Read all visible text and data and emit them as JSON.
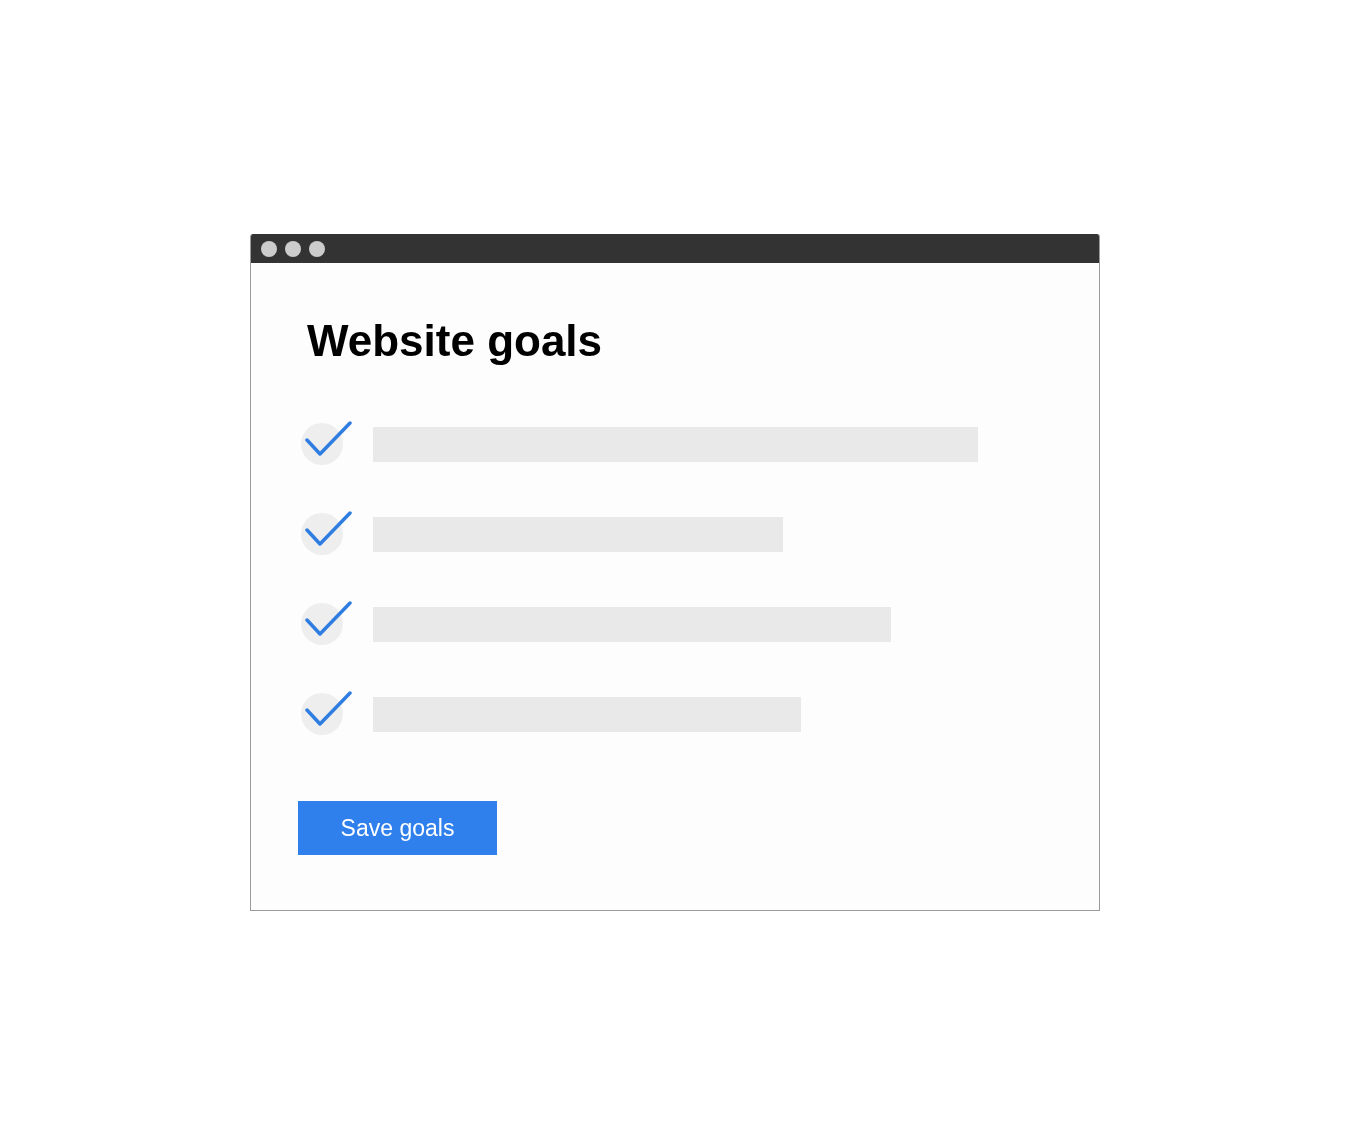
{
  "title": "Website goals",
  "goals": [
    {
      "checked": true
    },
    {
      "checked": true
    },
    {
      "checked": true
    },
    {
      "checked": true
    }
  ],
  "button": {
    "label": "Save goals"
  }
}
